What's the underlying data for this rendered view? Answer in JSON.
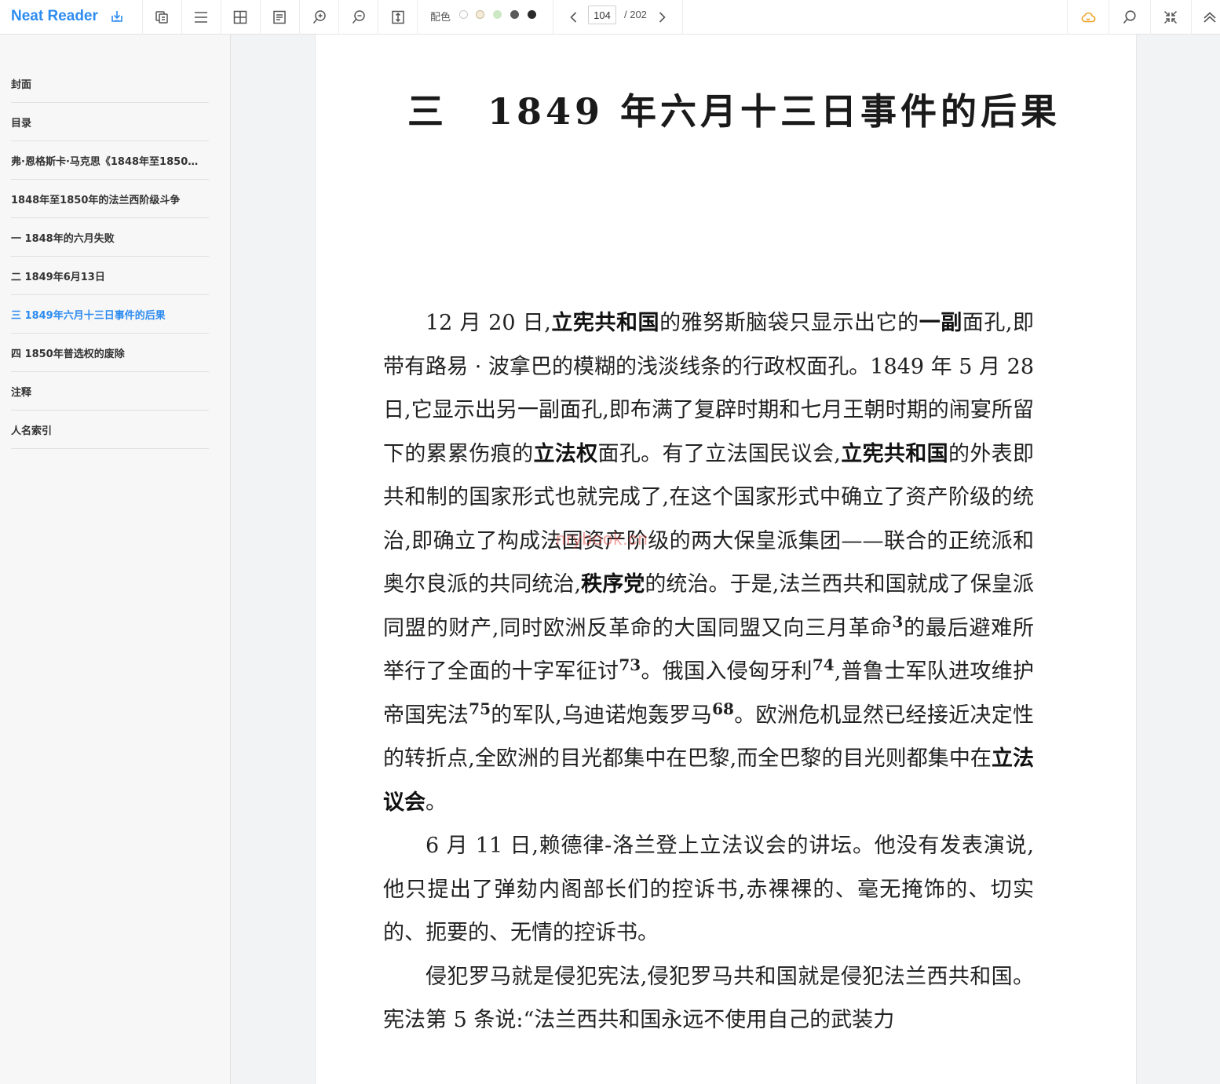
{
  "app": {
    "brand": "Neat Reader"
  },
  "toolbar": {
    "color_label": "配色",
    "swatches": [
      "#ffffff",
      "#f4ecd8",
      "#cde8c4",
      "#5a5a5a",
      "#2b2b2b"
    ],
    "page_current": "104",
    "page_total": "/ 202",
    "icons": [
      "download-icon",
      "copy-icon",
      "menu-icon",
      "grid-icon",
      "notes-icon",
      "zoom-in-icon",
      "zoom-out-icon",
      "fit-height-icon",
      "chevron-left-icon",
      "chevron-right-icon",
      "cloud-icon",
      "search-icon",
      "collapse-icon",
      "chevron-up-icon"
    ],
    "accent": "#2d8cf0",
    "cloud_color": "#f0a020"
  },
  "sidebar": {
    "items": [
      {
        "label": "封面"
      },
      {
        "label": "目录"
      },
      {
        "label": "弗·恩格斯卡·马克思《1848年至1850…"
      },
      {
        "label": "1848年至1850年的法兰西阶级斗争"
      },
      {
        "label": "一 1848年的六月失败"
      },
      {
        "label": "二 1849年6月13日"
      },
      {
        "label": "三 1849年六月十三日事件的后果"
      },
      {
        "label": "四 1850年普选权的废除"
      },
      {
        "label": "注释"
      },
      {
        "label": "人名索引"
      }
    ],
    "active_index": 6
  },
  "page": {
    "title": "三　1849 年六月十三日事件的后果",
    "watermark": "nrybook.cn",
    "paragraphs": [
      [
        {
          "t": "12 月 20 日,"
        },
        {
          "t": "立宪共和国",
          "b": true
        },
        {
          "t": "的雅努斯脑袋只显示出它的"
        },
        {
          "t": "一副",
          "b": true
        },
        {
          "t": "面孔,即带有路易 · 波拿巴的模糊的浅淡线条的行政权面孔。1849 年 5 月 28 日,它显示出另一副面孔,即布满了复辟时期和七月王朝时期的闹宴所留下的累累伤痕的"
        },
        {
          "t": "立法权",
          "b": true
        },
        {
          "t": "面孔。有了立法国民议会,"
        },
        {
          "t": "立宪共和国",
          "b": true
        },
        {
          "t": "的外表即共和制的国家形式也就完成了,在这个国家形式中确立了资产阶级的统治,即确立了构成法国资产阶级的两大保皇派集团——联合的正统派和奥尔良派的共同统治,"
        },
        {
          "t": "秩序党",
          "b": true
        },
        {
          "t": "的统治。于是,法兰西共和国就成了保皇派同盟的财产,同时欧洲反革命的大国同盟又向三月革命"
        },
        {
          "t": "3",
          "sup": true
        },
        {
          "t": "的最后避难所举行了全面的十字军征讨"
        },
        {
          "t": "73",
          "sup": true
        },
        {
          "t": "。俄国入侵匈牙利"
        },
        {
          "t": "74",
          "sup": true
        },
        {
          "t": ",普鲁士军队进攻维护帝国宪法"
        },
        {
          "t": "75",
          "sup": true
        },
        {
          "t": "的军队,乌迪诺炮轰罗马"
        },
        {
          "t": "68",
          "sup": true
        },
        {
          "t": "。欧洲危机显然已经接近决定性的转折点,全欧洲的目光都集中在巴黎,而全巴黎的目光则都集中在"
        },
        {
          "t": "立法议会",
          "b": true
        },
        {
          "t": "。"
        }
      ],
      [
        {
          "t": "6 月 11 日,赖德律-洛兰登上立法议会的讲坛。他没有发表演说,他只提出了弹劾内阁部长们的控诉书,赤裸裸的、毫无掩饰的、切实的、扼要的、无情的控诉书。"
        }
      ],
      [
        {
          "t": "侵犯罗马就是侵犯宪法,侵犯罗马共和国就是侵犯法兰西共和国。宪法第 5 条说:“法兰西共和国永远不使用自己的武装力"
        }
      ]
    ]
  }
}
